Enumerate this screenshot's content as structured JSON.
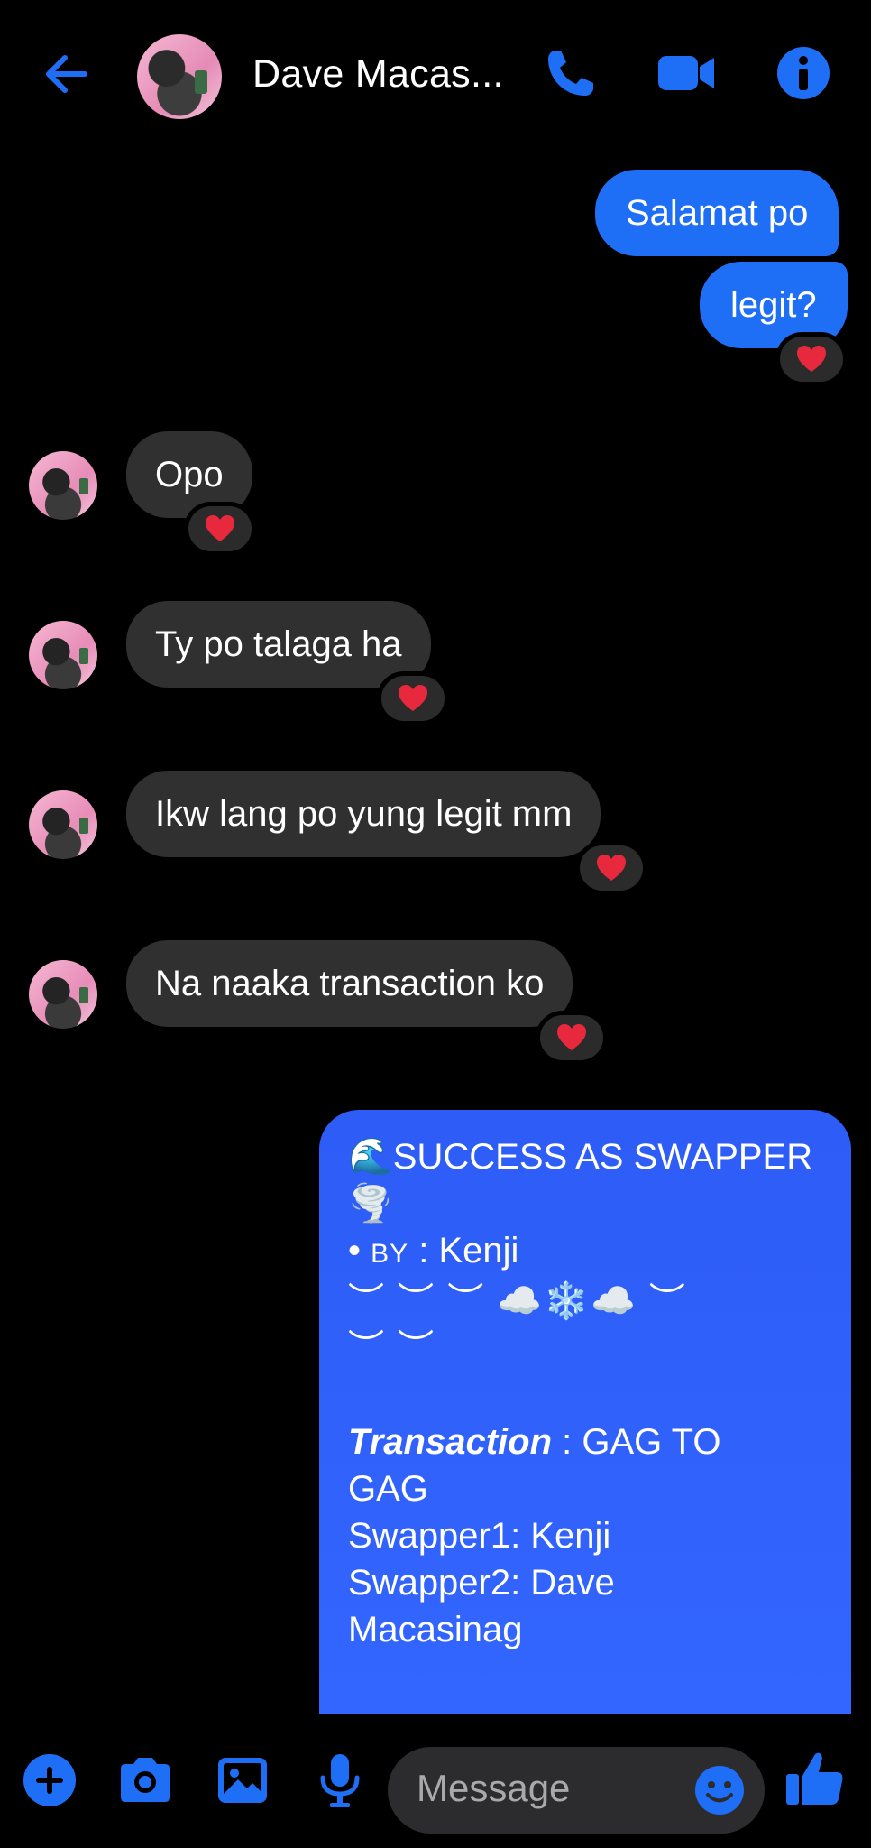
{
  "header": {
    "contact_name": "Dave Macas...",
    "icons": [
      "back-arrow-icon",
      "phone-icon",
      "video-camera-icon",
      "info-icon"
    ]
  },
  "messages": [
    {
      "from": "me",
      "text": "Salamat po"
    },
    {
      "from": "me",
      "text": "legit?",
      "reaction": "❤️"
    },
    {
      "from": "them",
      "text": "Opo",
      "reaction": "❤️"
    },
    {
      "from": "them",
      "text": "Ty po talaga ha",
      "reaction": "❤️"
    },
    {
      "from": "them",
      "text": "Ikw lang po yung legit mm",
      "reaction": "❤️"
    },
    {
      "from": "them",
      "text": "Na naaka transaction ko",
      "reaction": "❤️"
    }
  ],
  "card": {
    "title": "🌊SUCCESS AS SWAPPER",
    "title_emoji": "🌪️",
    "by_prefix": "• ",
    "by_label": "BY",
    "by_value": " : Kenji",
    "deco_line1": "︶ ︶ ︶ ☁️❄️☁️ ︶",
    "deco_line2": "︶ ︶",
    "transaction_label": "Transaction",
    "transaction_value1": " : GAG TO",
    "transaction_value2": "GAG",
    "swapper1": "Swapper1: Kenji",
    "swapper2_line1": "Swapper2: Dave",
    "swapper2_line2": "Macasinag"
  },
  "composer": {
    "placeholder": "Message",
    "icons": [
      "add-icon",
      "camera-icon",
      "gallery-icon",
      "microphone-icon",
      "emoji-icon",
      "thumbs-up-icon"
    ]
  },
  "colors": {
    "accent": "#1f6ff6",
    "incoming_bubble": "#303030",
    "reaction_heart": "#e8283c"
  }
}
